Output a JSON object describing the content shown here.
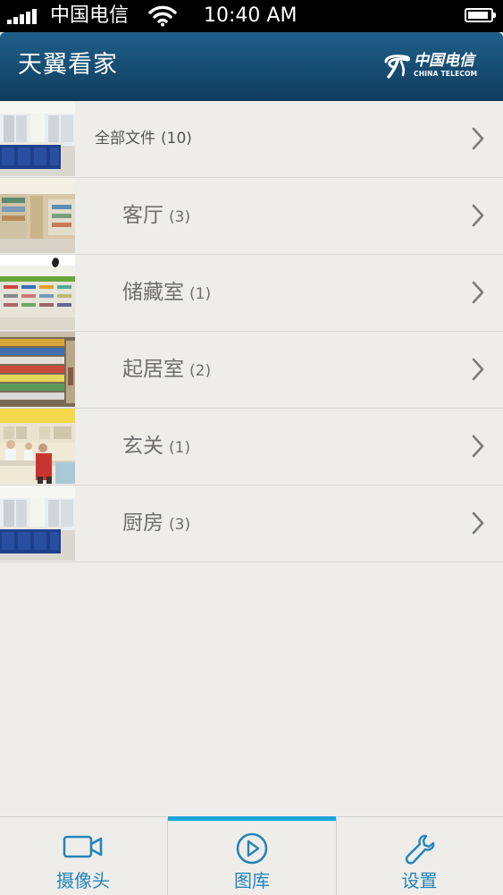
{
  "status_bar": {
    "carrier": "中国电信",
    "time": "10:40 AM",
    "signal_icon": "signal-icon",
    "wifi_icon": "wifi-icon",
    "battery_icon": "battery-icon",
    "battery_level": 0.9
  },
  "header": {
    "title": "天翼看家",
    "brand_cn": "中国电信",
    "brand_en": "CHINA TELECOM",
    "brand_icon": "china-telecom-logo",
    "background": "#1a5580"
  },
  "folders": [
    {
      "label": "全部文件",
      "count": "(10)",
      "thumb": "store-counter"
    },
    {
      "label": "客厅",
      "count": "(3)",
      "thumb": "store-aisle"
    },
    {
      "label": "储藏室",
      "count": "(1)",
      "thumb": "store-shelves-green"
    },
    {
      "label": "起居室",
      "count": "(2)",
      "thumb": "pharmacy-shelves"
    },
    {
      "label": "玄关",
      "count": "(1)",
      "thumb": "pharmacy-counter"
    },
    {
      "label": "厨房",
      "count": "(3)",
      "thumb": "store-counter"
    }
  ],
  "tabs": [
    {
      "label": "摄像头",
      "icon": "video-camera-icon",
      "active": false
    },
    {
      "label": "图库",
      "icon": "play-circle-icon",
      "active": true
    },
    {
      "label": "设置",
      "icon": "wrench-icon",
      "active": false
    }
  ],
  "colors": {
    "accent": "#2585b8",
    "active_indicator": "#1aa5d8",
    "list_background": "#efedea"
  }
}
